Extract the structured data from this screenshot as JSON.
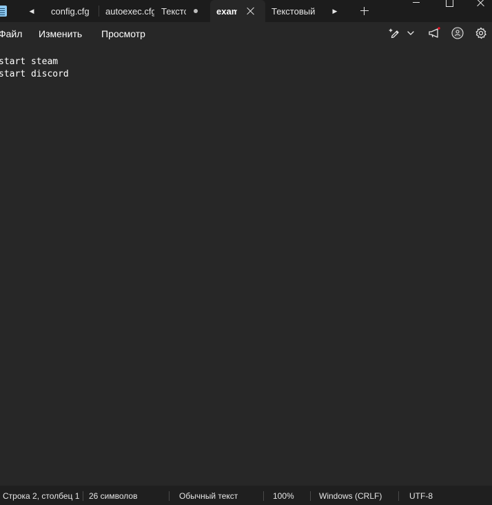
{
  "tabs": [
    {
      "label": "config.cfg"
    },
    {
      "label": "autoexec.cfg"
    },
    {
      "label": "Текстс",
      "modified": true
    },
    {
      "label": "examp",
      "active": true
    },
    {
      "label": "Текстовый д"
    }
  ],
  "menu": [
    "Файл",
    "Изменить",
    "Просмотр"
  ],
  "toolbar_icons": [
    "copilot-pen-icon",
    "chevron-down-icon",
    "megaphone-icon",
    "account-icon",
    "settings-icon"
  ],
  "editor": {
    "lines": [
      "start steam",
      "start discord"
    ]
  },
  "status": {
    "position": "Строка 2, столбец 1",
    "chars": "26 символов",
    "format": "Обычный текст",
    "zoom": "100%",
    "line_ending": "Windows (CRLF)",
    "encoding": "UTF-8"
  },
  "colors": {
    "background": "#272727",
    "titlebar": "#1c1c1c",
    "statusbar": "#1f1f1f",
    "notification_dot": "#e81123"
  }
}
